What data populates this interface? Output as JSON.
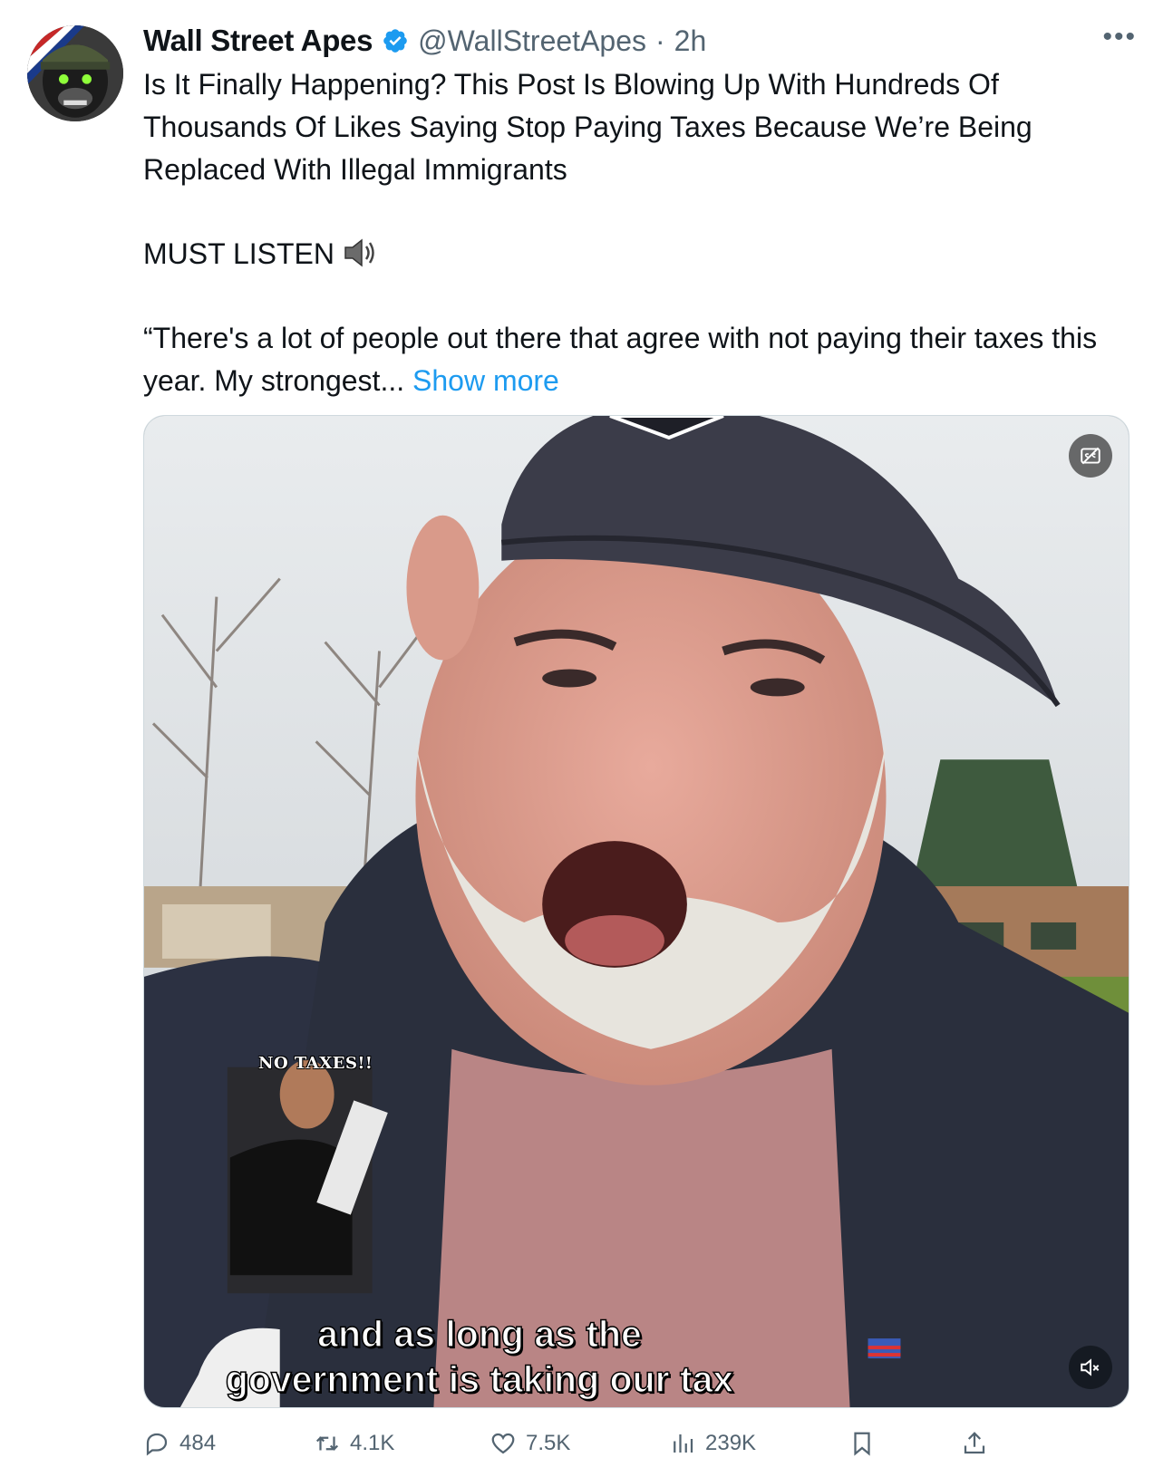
{
  "tweet": {
    "display_name": "Wall Street Apes",
    "handle": "@WallStreetApes",
    "separator": "·",
    "time": "2h",
    "more_label": "•••",
    "verified_icon": "verified-badge-icon",
    "text_line_1": "Is It Finally Happening? This Post Is Blowing Up With Hundreds Of Thousands Of Likes Saying Stop Paying Taxes Because We’re Being Replaced With Illegal Immigrants",
    "text_line_2": "MUST LISTEN",
    "text_line_3": "“There's a lot of people out there that agree with not paying their taxes this year. My strongest...",
    "show_more": "Show more"
  },
  "media": {
    "inset_label": "NO TAXES!!",
    "caption_line_1": "and as long as the",
    "caption_line_2": "government is taking our tax"
  },
  "actions": {
    "replies": "484",
    "reposts": "4.1K",
    "likes": "7.5K",
    "views": "239K"
  },
  "colors": {
    "link": "#1d9bf0",
    "secondary_text": "#536471",
    "verified": "#1d9bf0"
  }
}
